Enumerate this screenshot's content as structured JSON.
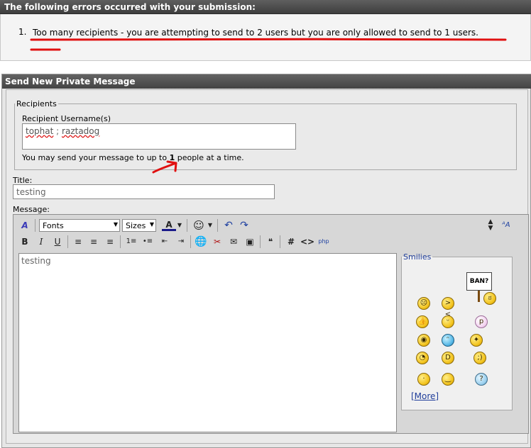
{
  "errors": {
    "header": "The following errors occurred with your submission:",
    "items": [
      {
        "number": "1.",
        "text": "Too many recipients - you are attempting to send to 2 users but you are only allowed to send to 1 users."
      }
    ]
  },
  "panel": {
    "title": "Send New Private Message"
  },
  "recipients": {
    "legend": "Recipients",
    "field_label": "Recipient Username(s)",
    "name1": "tophat",
    "separator": ";",
    "name2": "raztadog",
    "limit_prefix": "You may send your message to up to ",
    "limit_value": "1",
    "limit_suffix": " people at a time."
  },
  "title_field": {
    "label": "Title:",
    "value": "testing"
  },
  "message": {
    "label": "Message:",
    "value": "testing"
  },
  "toolbar": {
    "font_select": "Fonts",
    "size_select": "Sizes"
  },
  "smilies": {
    "legend": "Smilies",
    "ban_sign": "BAN?",
    "more_link": "[More]"
  },
  "colors": {
    "accent_link": "#1f3d9a",
    "annotation_red": "#e01010"
  }
}
